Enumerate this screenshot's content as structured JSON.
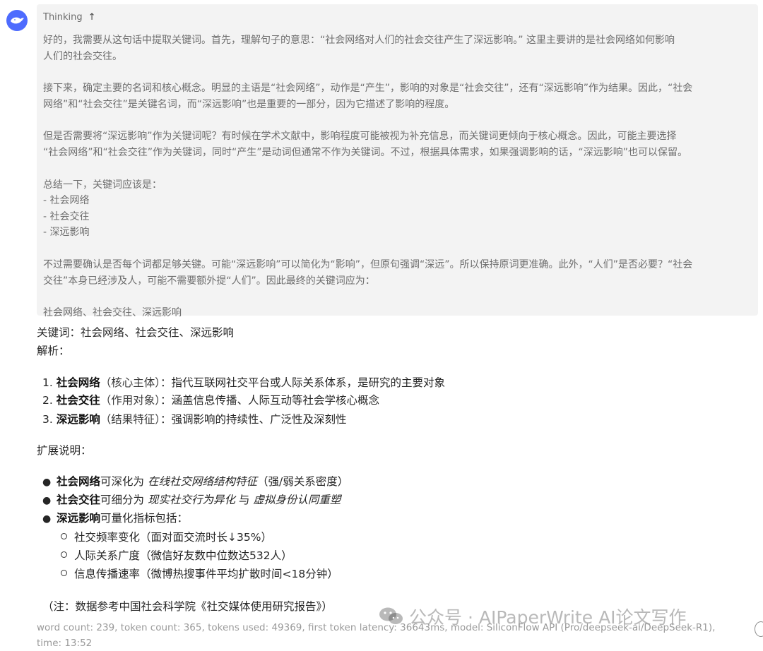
{
  "assistant": {
    "avatar_icon": "deepseek-whale-icon",
    "accent": "#4d6bfe"
  },
  "thinking": {
    "label": "Thinking",
    "toggle_icon": "arrow-up-icon",
    "paragraphs": [
      "好的，我需要从这句话中提取关键词。首先，理解句子的意思：“社会网络对人们的社会交往产生了深远影响。” 这里主要讲的是社会网络如何影响\n人们的社会交往。",
      "接下来，确定主要的名词和核心概念。明显的主语是“社会网络”，动作是“产生”，影响的对象是“社会交往”，还有“深远影响”作为结果。因此，“社会\n网络”和“社会交往”是关键名词，而“深远影响”也是重要的一部分，因为它描述了影响的程度。",
      "但是否需要将“深远影响”作为关键词呢？有时候在学术文献中，影响程度可能被视为补充信息，而关键词更倾向于核心概念。因此，可能主要选择\n“社会网络”和“社会交往”作为关键词，同时“产生”是动词但通常不作为关键词。不过，根据具体需求，如果强调影响的话，“深远影响”也可以保留。",
      "总结一下，关键词应该是：\n- 社会网络\n- 社会交往\n- 深远影响",
      "不过需要确认是否每个词都足够关键。可能“深远影响”可以简化为“影响”，但原句强调“深远”。所以保持原词更准确。此外，“人们”是否必要？“社会\n交往”本身已经涉及人，可能不需要额外提“人们”。因此最终的关键词应为：",
      "社会网络、社会交往、深远影响"
    ]
  },
  "answer": {
    "keywords_line": "关键词：社会网络、社会交往、深远影响",
    "analysis_label": "解析：",
    "ordered": [
      {
        "num": "1.",
        "term": "社会网络",
        "role": "（核心主体）",
        "desc": "：指代互联网社交平台或人际关系体系，是研究的主要对象"
      },
      {
        "num": "2.",
        "term": "社会交往",
        "role": "（作用对象）",
        "desc": "：涵盖信息传播、人际互动等社会学核心概念"
      },
      {
        "num": "3.",
        "term": "深远影响",
        "role": "（结果特征）",
        "desc": "：强调影响的持续性、广泛性及深刻性"
      }
    ],
    "extension_label": "扩展说明：",
    "bullets": [
      {
        "term": "社会网络",
        "pre": "可深化为 ",
        "em1": "在线社交网络结构特征",
        "mid": "",
        "em2": "",
        "post": "（强/弱关系密度）"
      },
      {
        "term": "社会交往",
        "pre": "可细分为 ",
        "em1": "现实社交行为异化",
        "mid": " 与 ",
        "em2": "虚拟身份认同重塑",
        "post": ""
      },
      {
        "term": "深远影响",
        "pre": "可量化指标包括：",
        "em1": "",
        "mid": "",
        "em2": "",
        "post": ""
      }
    ],
    "sub_bullets": [
      "社交频率变化（面对面交流时长↓35%）",
      "人际关系广度（微信好友数中位数达532人）",
      "信息传播速率（微博热搜事件平均扩散时间<18分钟）"
    ],
    "note": "（注：数据参考中国社会科学院《社交媒体使用研究报告》）"
  },
  "footer": {
    "line1": "word count: 239, token count: 365, tokens used: 49369, first token latency: 36643ms, model: SiliconFlow API (Pro/deepseek-ai/DeepSeek-R1),",
    "line2": "time: 13:52"
  },
  "watermark": {
    "icon": "wechat-icon",
    "text": "公众号 · AIPaperWrite AI论文写作"
  }
}
